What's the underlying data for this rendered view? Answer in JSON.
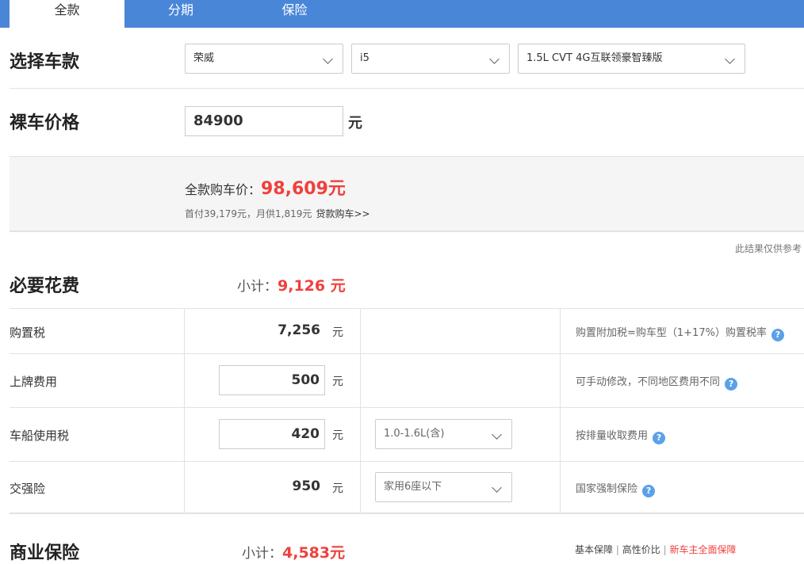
{
  "tabs": [
    {
      "label": "全款"
    },
    {
      "label": "分期"
    },
    {
      "label": "保险"
    }
  ],
  "select_car": {
    "title": "选择车款",
    "brand": "荣威",
    "model": "i5",
    "version": "1.5L CVT 4G互联领豪智臻版"
  },
  "price": {
    "title": "裸车价格",
    "value": "84900",
    "unit": "元"
  },
  "summary": {
    "label": "全款购车价：",
    "total": "98,609元",
    "sub": "首付39,179元，月供1,819元",
    "loan_link": "贷款购车>>"
  },
  "disclaimer": "此结果仅供参考",
  "necessary": {
    "title": "必要花费",
    "subtotal_label": "小计：",
    "subtotal": "9,126 元",
    "rows": [
      {
        "label": "购置税",
        "amount": "7,256",
        "unit": "元",
        "note": "购置附加税=购车型（1+17%）购置税率"
      },
      {
        "label": "上牌费用",
        "amount": "500",
        "unit": "元",
        "note": "可手动修改，不同地区费用不同"
      },
      {
        "label": "车船使用税",
        "amount": "420",
        "unit": "元",
        "option": "1.0-1.6L(含)",
        "note": "按排量收取费用"
      },
      {
        "label": "交强险",
        "amount": "950",
        "unit": "元",
        "option": "家用6座以下",
        "note": "国家强制保险"
      }
    ]
  },
  "commercial": {
    "title": "商业保险",
    "subtotal_label": "小计：",
    "subtotal": "4,583元",
    "links": [
      "基本保障",
      "高性价比",
      "新车主全面保障"
    ],
    "separator": "|"
  },
  "help_glyph": "?",
  "colors": {
    "accent": "#4a86d8",
    "red": "#f0403c",
    "help": "#5aa1e8"
  }
}
